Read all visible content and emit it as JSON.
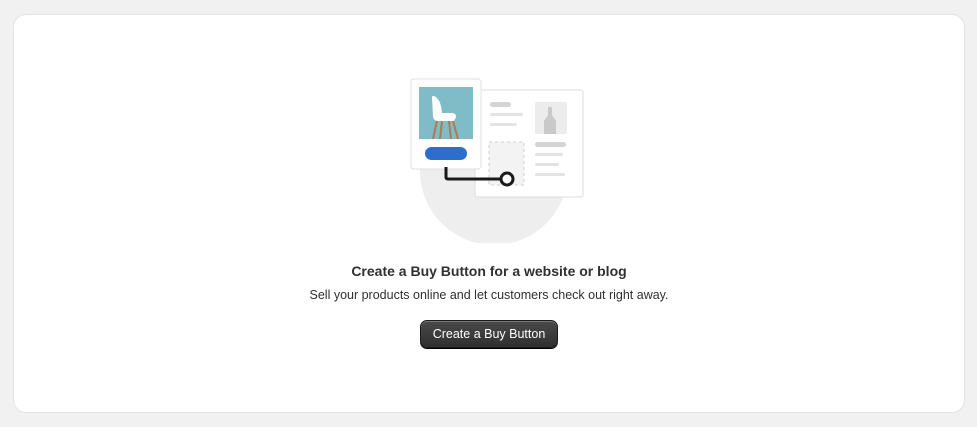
{
  "empty_state": {
    "title": "Create a Buy Button for a website or blog",
    "description": "Sell your products online and let customers check out right away.",
    "button_label": "Create a Buy Button",
    "illustration_icon": "buy-button-illustration"
  },
  "colors": {
    "page_background": "#f1f1f1",
    "card_background": "#ffffff",
    "button_background": "#303030",
    "product_tile": "#7fbcc7",
    "accent_pill": "#2c6ecb"
  }
}
